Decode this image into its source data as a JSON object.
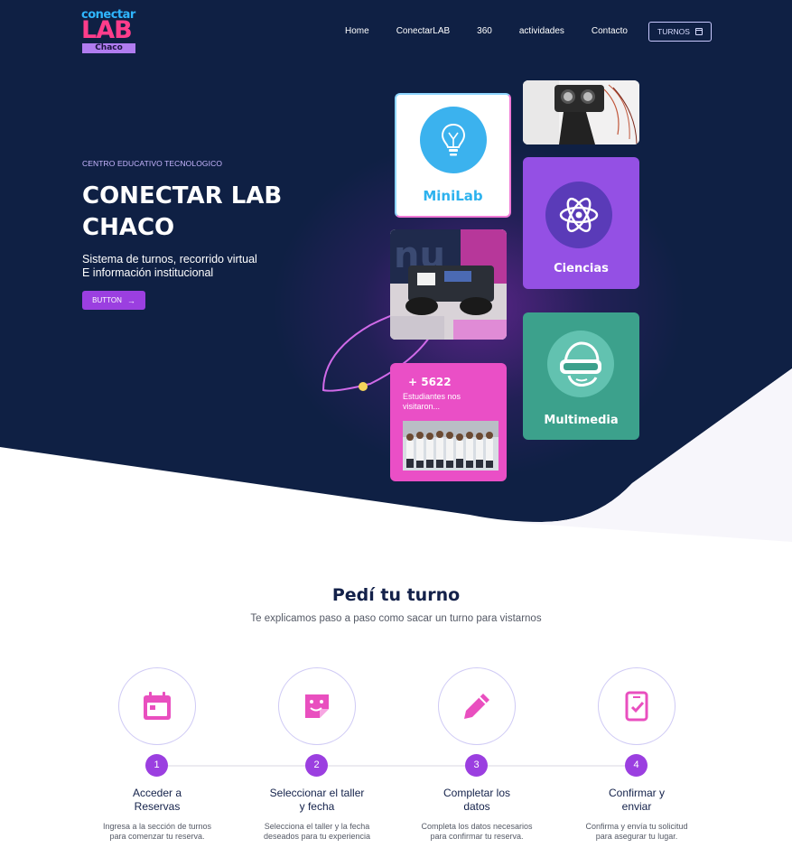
{
  "logo": {
    "line1": "conectar",
    "line2": "LAB",
    "line3": "Chaco"
  },
  "nav": {
    "items": [
      "Home",
      "ConectarLAB",
      "360",
      "actividades",
      "Contacto"
    ],
    "turnos_label": "TURNOS"
  },
  "hero": {
    "eyebrow": "CENTRO EDUCATIVO TECNOLOGICO",
    "title_line1": "CONECTAR LAB",
    "title_line2": "CHACO",
    "subtitle_line1": "Sistema de turnos, recorrido virtual",
    "subtitle_line2": "E información institucional",
    "button_label": "BUTTON",
    "button_arrow": "→"
  },
  "cards": {
    "minilab_label": "MiniLab",
    "ciencias_label": "Ciencias",
    "multimedia_label": "Multimedia",
    "stats_number": "+ 5622",
    "stats_text": "Estudiantes nos visitaron..."
  },
  "turnos_section": {
    "title": "Pedí tu turno",
    "subtitle": "Te explicamos paso a paso como sacar un turno para vistarnos",
    "steps": [
      {
        "num": "1",
        "title_line1": "Acceder a",
        "title_line2": "Reservas",
        "desc_line1": "Ingresa a la sección de turnos",
        "desc_line2": "para comenzar tu reserva.",
        "icon": "calendar-icon"
      },
      {
        "num": "2",
        "title_line1": "Seleccionar el taller",
        "title_line2": "y fecha",
        "desc_line1": "Selecciona el taller y la fecha",
        "desc_line2": "deseados para tu experiencia",
        "icon": "sticker-icon"
      },
      {
        "num": "3",
        "title_line1": "Completar los",
        "title_line2": "datos",
        "desc_line1": "Completa los datos necesarios",
        "desc_line2": "para confirmar tu reserva.",
        "icon": "pencil-icon"
      },
      {
        "num": "4",
        "title_line1": "Confirmar y",
        "title_line2": "enviar",
        "desc_line1": "Confirma y envía tu solicitud",
        "desc_line2": "para asegurar tu lugar.",
        "icon": "phone-check-icon"
      }
    ]
  },
  "colors": {
    "hero_bg": "#0f2044",
    "accent_purple": "#9b3fe0",
    "accent_pink": "#ea4fc6",
    "icon_pink": "#e94fbf",
    "teal": "#3ca18c",
    "cyan": "#3bb2ee"
  }
}
